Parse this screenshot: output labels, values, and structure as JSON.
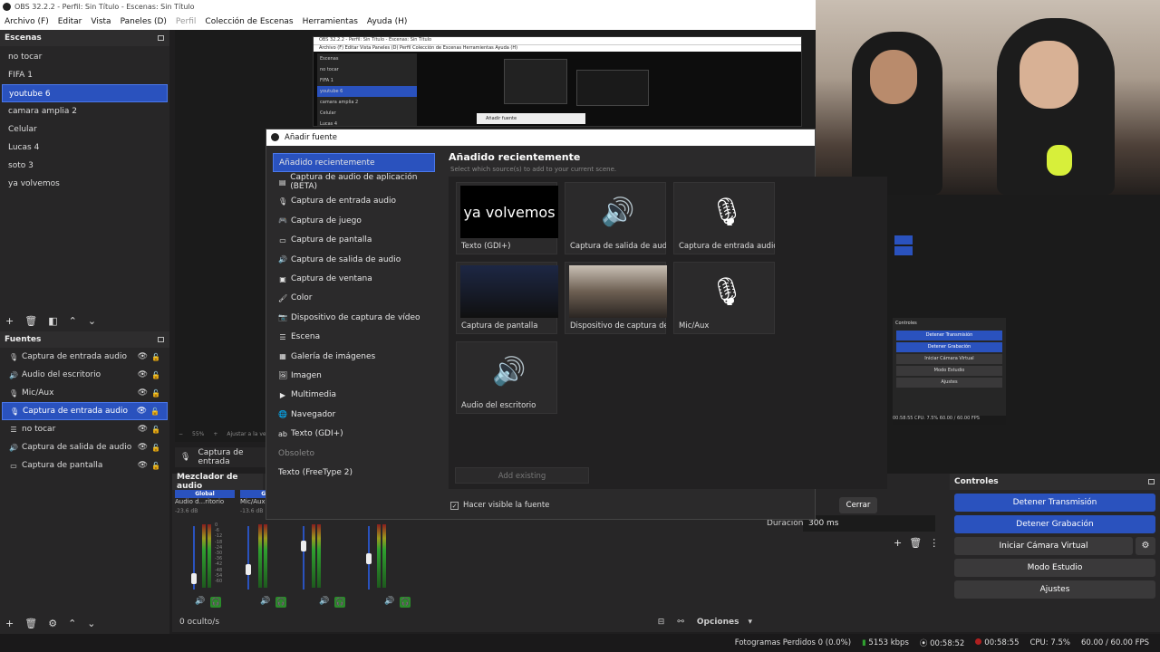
{
  "window": {
    "title": "OBS 32.2.2 - Perfil: Sin Título - Escenas: Sin Título"
  },
  "menu": [
    "Archivo (F)",
    "Editar",
    "Vista",
    "Paneles (D)",
    "Perfil",
    "Colección de Escenas",
    "Herramientas",
    "Ayuda (H)"
  ],
  "scenes": {
    "title": "Escenas",
    "items": [
      "no tocar",
      "FIFA 1",
      "youtube 6",
      "camara amplia 2",
      "Celular",
      "Lucas 4",
      "soto 3",
      "ya volvemos"
    ],
    "selected": "youtube 6"
  },
  "sources": {
    "title": "Fuentes",
    "items": [
      {
        "label": "Captura de entrada audio",
        "icon": "mic-icon"
      },
      {
        "label": "Audio del escritorio",
        "icon": "speaker-icon"
      },
      {
        "label": "Mic/Aux",
        "icon": "mic-icon"
      },
      {
        "label": "Captura de entrada audio",
        "icon": "mic-icon"
      },
      {
        "label": "no tocar",
        "icon": "list-icon"
      },
      {
        "label": "Captura de salida de audio",
        "icon": "speaker-icon"
      },
      {
        "label": "Captura de pantalla",
        "icon": "monitor-icon"
      }
    ],
    "selected_index": 3
  },
  "preview": {
    "zoom": "55%",
    "fit_label": "Ajustar a la ve",
    "nested_title": "OBS 32.2.2 - Perfil: Sin Título - Escenas: Sin Título",
    "nested_menu": "Archivo (F)   Editar   Vista   Paneles (D)   Perfil   Colección de Escenas   Herramientas   Ayuda (H)",
    "nested_scenes_title": "Escenas",
    "nested_scenes": [
      "no tocar",
      "FIFA 1",
      "youtube 6",
      "camara amplia 2",
      "Celular",
      "Lucas 4"
    ],
    "nested_dialog": "Añadir fuente"
  },
  "source_props": {
    "label": "Captura de entrada"
  },
  "mixer": {
    "title": "Mezclador de audio",
    "strips": [
      {
        "label": "Audio d...ritorio",
        "db": "-23.6 dB",
        "global": "Global"
      },
      {
        "label": "Mic/Aux",
        "db": "-13.6 dB",
        "global": "Globa"
      },
      {
        "label": "",
        "db": "",
        "global": ""
      },
      {
        "label": "",
        "db": "",
        "global": ""
      }
    ],
    "ticks": [
      "0",
      "-6",
      "-12",
      "-18",
      "-24",
      "-30",
      "-36",
      "-42",
      "-48",
      "-54",
      "-60"
    ],
    "hidden": "0 oculto/s"
  },
  "transitions": {
    "duration_label": "Duración",
    "duration_value": "300 ms"
  },
  "controls": {
    "title": "Controles",
    "stop_stream": "Detener Transmisión",
    "stop_record": "Detener Grabación",
    "virtual_cam": "Iniciar Cámara Virtual",
    "studio_mode": "Modo Estudio",
    "settings": "Ajustes",
    "options": "Opciones"
  },
  "statusbar": {
    "dropped": "Fotogramas Perdidos 0 (0.0%)",
    "bitrate": "5153 kbps",
    "stream_time": "00:58:52",
    "rec_time": "00:58:55",
    "cpu": "CPU: 7.5%",
    "fps": "60.00 / 60.00 FPS"
  },
  "dialog": {
    "title": "Añadir fuente",
    "types": [
      {
        "label": "Añadido recientemente",
        "icon": ""
      },
      {
        "label": "Captura de audio de aplicación (BETA)",
        "icon": "app-audio-icon"
      },
      {
        "label": "Captura de entrada audio",
        "icon": "mic-icon"
      },
      {
        "label": "Captura de juego",
        "icon": "gamepad-icon"
      },
      {
        "label": "Captura de pantalla",
        "icon": "monitor-icon"
      },
      {
        "label": "Captura de salida de audio",
        "icon": "speaker-icon"
      },
      {
        "label": "Captura de ventana",
        "icon": "window-icon"
      },
      {
        "label": "Color",
        "icon": "brush-icon"
      },
      {
        "label": "Dispositivo de captura de vídeo",
        "icon": "camera-icon"
      },
      {
        "label": "Escena",
        "icon": "list-icon"
      },
      {
        "label": "Galería de imágenes",
        "icon": "gallery-icon"
      },
      {
        "label": "Imagen",
        "icon": "image-icon"
      },
      {
        "label": "Multimedia",
        "icon": "play-icon"
      },
      {
        "label": "Navegador",
        "icon": "globe-icon"
      },
      {
        "label": "Texto (GDI+)",
        "icon": "text-icon"
      },
      {
        "label": "Obsoleto",
        "icon": ""
      },
      {
        "label": "Texto (FreeType 2)",
        "icon": ""
      }
    ],
    "recent_title": "Añadido recientemente",
    "recent_sub": "Select which source(s) to add to your current scene.",
    "tiles": [
      {
        "label": "Texto (GDI+)",
        "thumb_text": "ya volvemos"
      },
      {
        "label": "Captura de salida de audio",
        "thumb_text": ""
      },
      {
        "label": "Captura de entrada audio",
        "thumb_text": ""
      },
      {
        "label": "Captura de pantalla",
        "thumb_text": ""
      },
      {
        "label": "Dispositivo de captura de vídeo",
        "thumb_text": ""
      },
      {
        "label": "Mic/Aux",
        "thumb_text": ""
      },
      {
        "label": "Audio del escritorio",
        "thumb_text": ""
      }
    ],
    "add_existing": "Add existing",
    "visible_label": "Hacer visible la fuente",
    "close": "Cerrar"
  },
  "nested_controls": {
    "title": "Controles",
    "items": [
      "Detener Transmisión",
      "Detener Grabación",
      "Iniciar Cámara Virtual",
      "Modo Estudio",
      "Ajustes"
    ],
    "status": "00:58:55   CPU: 7.5%   60.00 / 60.00 FPS"
  },
  "colors": {
    "accent": "#2a52be",
    "dock": "#272627",
    "background": "#1f1e1f"
  }
}
